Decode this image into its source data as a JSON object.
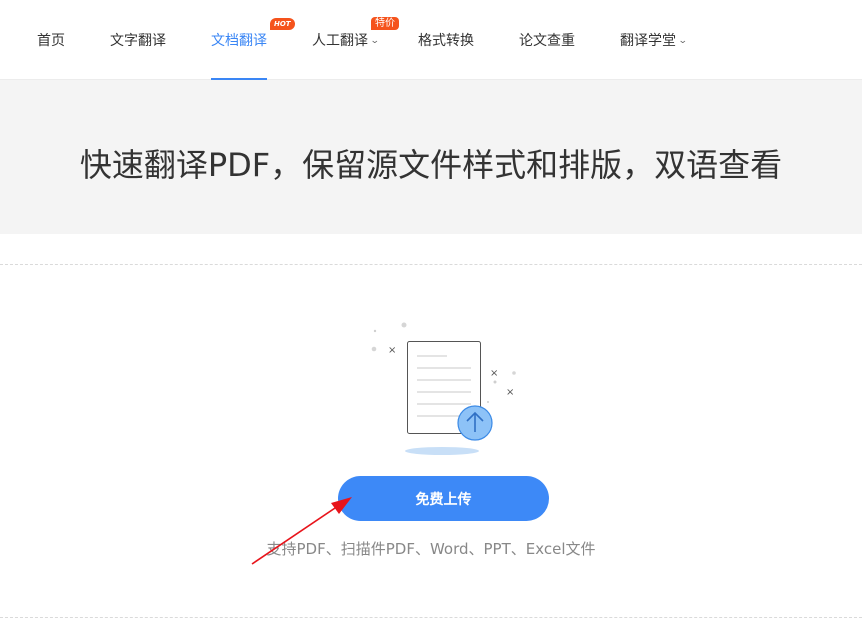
{
  "nav": {
    "items": [
      {
        "label": "首页"
      },
      {
        "label": "文字翻译"
      },
      {
        "label": "文档翻译",
        "badge": "HOT",
        "active": true
      },
      {
        "label": "人工翻译",
        "badge": "特价",
        "dropdown": true
      },
      {
        "label": "格式转换"
      },
      {
        "label": "论文查重"
      },
      {
        "label": "翻译学堂",
        "dropdown": true
      }
    ],
    "accent_color": "#3a86f5",
    "badge_color": "#f5531c"
  },
  "hero": {
    "title": "快速翻译PDF，保留源文件样式和排版，双语查看"
  },
  "upload": {
    "illustration_icon": "document-upload-icon",
    "button_label": "免费上传",
    "button_color": "#3d89f7",
    "support_text": "支持PDF、扫描件PDF、Word、PPT、Excel文件"
  },
  "annotation": {
    "icon": "red-arrow-icon",
    "color": "#e8141b"
  }
}
